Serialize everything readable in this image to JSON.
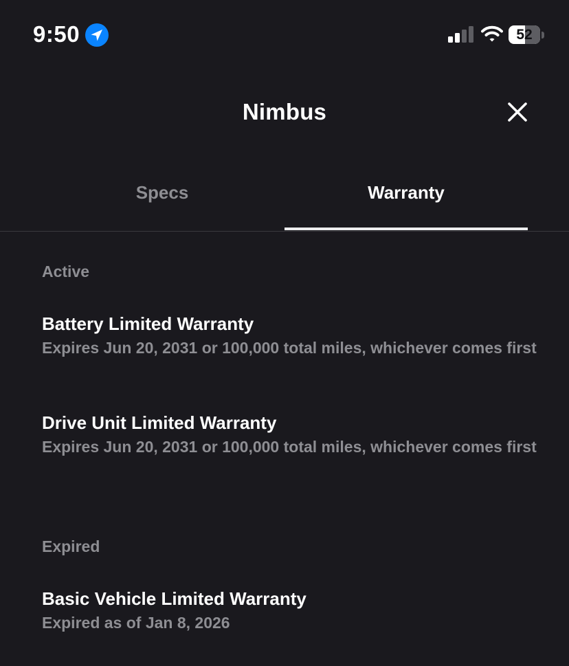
{
  "status_bar": {
    "time": "9:50",
    "battery_level": "52",
    "battery_percent": 52,
    "icons": [
      "location-arrow-icon",
      "cellular-signal-icon",
      "wifi-icon",
      "battery-icon"
    ],
    "location_color": "#0a84ff"
  },
  "header": {
    "title": "Nimbus",
    "close_icon": "close-icon"
  },
  "tabs": [
    {
      "label": "Specs",
      "selected": false
    },
    {
      "label": "Warranty",
      "selected": true
    }
  ],
  "sections": {
    "active": {
      "heading": "Active",
      "items": [
        {
          "title": "Battery Limited Warranty",
          "subtitle": "Expires Jun 20, 2031 or 100,000 total miles, whichever comes first"
        },
        {
          "title": "Drive Unit Limited Warranty",
          "subtitle": "Expires Jun 20, 2031 or 100,000 total miles, whichever comes first"
        }
      ]
    },
    "expired": {
      "heading": "Expired",
      "items": [
        {
          "title": "Basic Vehicle Limited Warranty",
          "subtitle": "Expired as of Jan 8, 2026"
        }
      ]
    }
  },
  "colors": {
    "background": "#1a191e",
    "primary_text": "#ffffff",
    "secondary_text": "#8e8e93",
    "tab_indicator": "#ececee"
  }
}
